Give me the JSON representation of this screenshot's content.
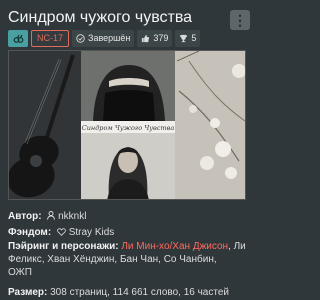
{
  "title": "Синдром чужого чувства",
  "badges": {
    "rating": "NC-17",
    "status": "Завершён",
    "likes": "379",
    "awards": "5"
  },
  "cover": {
    "caption": "Синдром Чужого Чувства"
  },
  "info": {
    "author_label": "Автор:",
    "author": "nkknkl",
    "fandom_label": "Фэндом:",
    "fandom": "Stray Kids",
    "pairing_label": "Пэйринг и персонажи:",
    "pairing_link": "Ли Мин-хо/Хан Джисон",
    "characters_line1": ", Ли Феликс, Хван Хёнджин, Бан Чан, Со Чанбин,",
    "characters_line2": "ОЖП",
    "size_label": "Размер:",
    "size": "308 страниц, 114 661 слово, 16 частей"
  },
  "colors": {
    "accent": "#ff6a5e",
    "direction_badge": "#4aa0a0",
    "background": "#2f373b"
  },
  "icons": {
    "direction": "male-male-icon",
    "status": "check-circle-icon",
    "likes": "thumbs-up-icon",
    "awards": "trophy-icon",
    "menu": "vertical-dots-icon",
    "author": "user-icon",
    "fandom": "heart-icon"
  }
}
